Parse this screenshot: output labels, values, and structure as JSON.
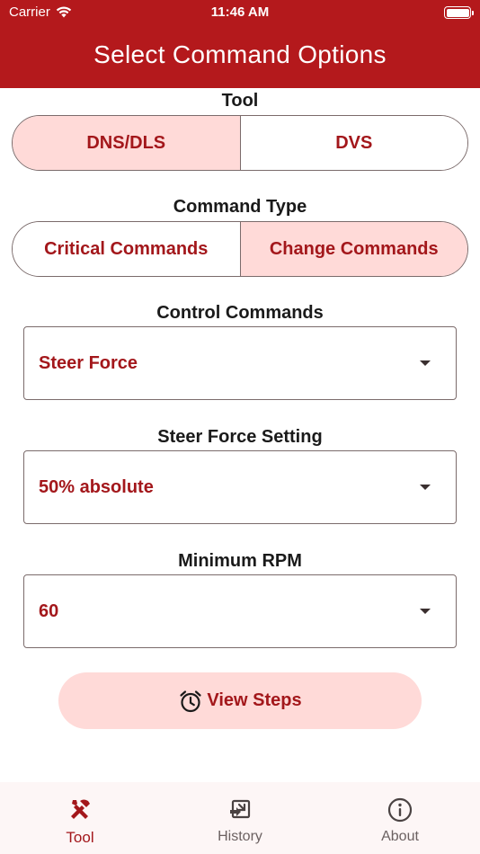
{
  "status_bar": {
    "carrier": "Carrier",
    "time": "11:46 AM"
  },
  "header": {
    "title": "Select Command Options"
  },
  "tool": {
    "label": "Tool",
    "options": [
      {
        "label": "DNS/DLS",
        "selected": true
      },
      {
        "label": "DVS",
        "selected": false
      }
    ]
  },
  "command_type": {
    "label": "Command Type",
    "options": [
      {
        "label": "Critical Commands",
        "selected": false
      },
      {
        "label": "Change Commands",
        "selected": true
      }
    ]
  },
  "control_commands": {
    "label": "Control Commands",
    "value": "Steer Force"
  },
  "steer_force_setting": {
    "label": "Steer Force Setting",
    "value": "50% absolute"
  },
  "minimum_rpm": {
    "label": "Minimum RPM",
    "value": "60"
  },
  "view_steps": {
    "label": "View Steps",
    "icon": "alarm-clock-icon"
  },
  "tabbar": {
    "items": [
      {
        "label": "Tool",
        "icon": "tools-icon",
        "active": true
      },
      {
        "label": "History",
        "icon": "history-icon",
        "active": false
      },
      {
        "label": "About",
        "icon": "info-icon",
        "active": false
      }
    ]
  },
  "colors": {
    "header_bg": "#b4191c",
    "accent_text": "#a3171b",
    "selected_bg": "#ffdad8",
    "border": "#7b6b6b"
  }
}
